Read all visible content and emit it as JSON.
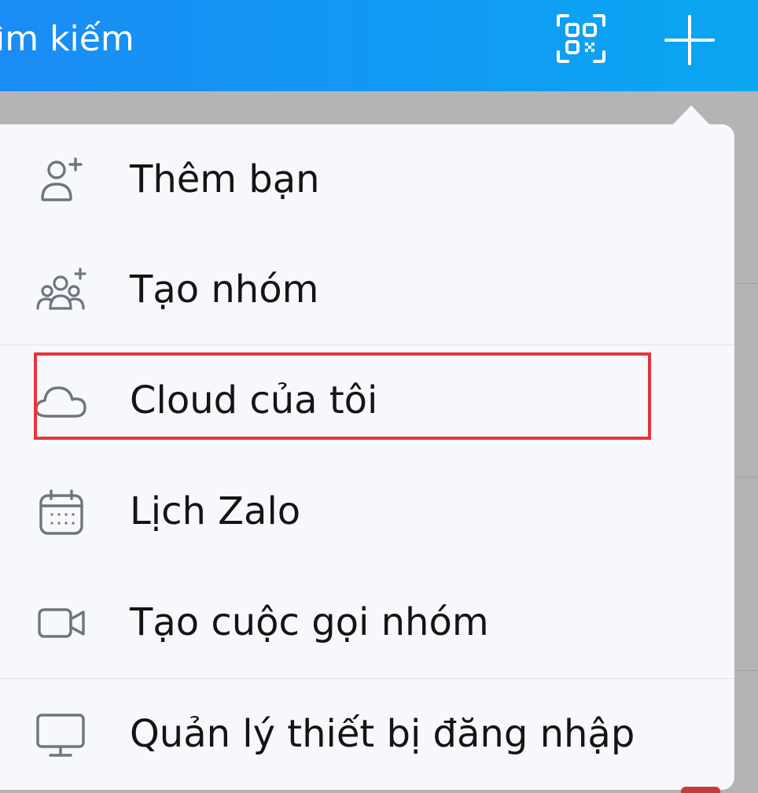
{
  "header": {
    "search_label": "ìm kiếm",
    "qr_icon": "qr-scan-icon",
    "add_icon": "plus-icon"
  },
  "menu": {
    "items": [
      {
        "label": "Thêm bạn",
        "icon": "add-friend-icon"
      },
      {
        "label": "Tạo nhóm",
        "icon": "create-group-icon"
      },
      {
        "label": "Cloud của tôi",
        "icon": "cloud-icon"
      },
      {
        "label": "Lịch Zalo",
        "icon": "calendar-icon"
      },
      {
        "label": "Tạo cuộc gọi nhóm",
        "icon": "video-call-icon"
      },
      {
        "label": "Quản lý thiết bị đăng nhập",
        "icon": "monitor-icon"
      }
    ]
  },
  "colors": {
    "header_start": "#1a8cf5",
    "header_end": "#0aa6f2",
    "menu_bg": "#f7f8fb",
    "highlight": "#e8323f",
    "icon": "#6f7480"
  }
}
